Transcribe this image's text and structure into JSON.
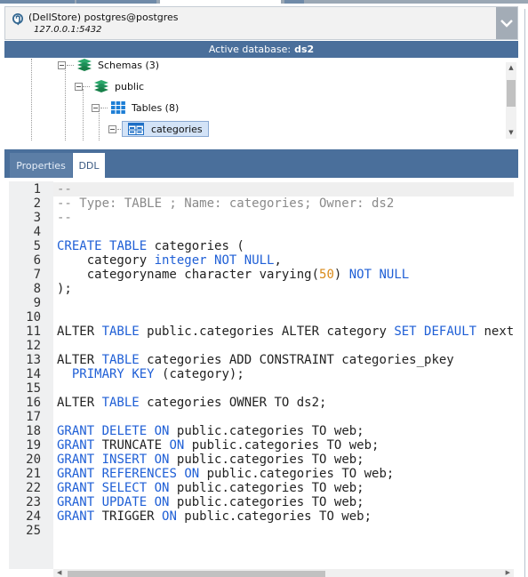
{
  "connection": {
    "title": "(DellStore) postgres@postgres",
    "host": "127.0.0.1:5432"
  },
  "active_database": {
    "label": "Active database:",
    "name": "ds2"
  },
  "tree": {
    "schemas": "Schemas (3)",
    "public": "public",
    "tables": "Tables (8)",
    "categories": "categories"
  },
  "tabs": {
    "properties": "Properties",
    "ddl": "DDL"
  },
  "colors": {
    "header_blue": "#4a6f9b",
    "keyword": "#1f5fd6",
    "comment": "#8a8a8a",
    "number": "#d98a1a"
  },
  "editor": {
    "line_numbers": [
      "1",
      "2",
      "3",
      "4",
      "5",
      "6",
      "7",
      "8",
      "9",
      "10",
      "11",
      "12",
      "13",
      "14",
      "15",
      "16",
      "17",
      "18",
      "19",
      "20",
      "21",
      "22",
      "23",
      "24",
      "25"
    ],
    "lines": [
      [
        [
          "com",
          "--"
        ]
      ],
      [
        [
          "com",
          "-- Type: TABLE ; Name: categories; Owner: ds2"
        ]
      ],
      [
        [
          "com",
          "--"
        ]
      ],
      [],
      [
        [
          "kw",
          "CREATE"
        ],
        [
          "plain",
          " "
        ],
        [
          "kw",
          "TABLE"
        ],
        [
          "plain",
          " categories ("
        ]
      ],
      [
        [
          "plain",
          "    category "
        ],
        [
          "kw",
          "integer"
        ],
        [
          "plain",
          " "
        ],
        [
          "kw",
          "NOT"
        ],
        [
          "plain",
          " "
        ],
        [
          "kw",
          "NULL"
        ],
        [
          "plain",
          ","
        ]
      ],
      [
        [
          "plain",
          "    categoryname character varying("
        ],
        [
          "num",
          "50"
        ],
        [
          "plain",
          ") "
        ],
        [
          "kw",
          "NOT"
        ],
        [
          "plain",
          " "
        ],
        [
          "kw",
          "NULL"
        ]
      ],
      [
        [
          "plain",
          ");"
        ]
      ],
      [],
      [],
      [
        [
          "plain",
          "ALTER "
        ],
        [
          "kw",
          "TABLE"
        ],
        [
          "plain",
          " public.categories ALTER category "
        ],
        [
          "kw",
          "SET"
        ],
        [
          "plain",
          " "
        ],
        [
          "kw",
          "DEFAULT"
        ],
        [
          "plain",
          " nextval"
        ]
      ],
      [],
      [
        [
          "plain",
          "ALTER "
        ],
        [
          "kw",
          "TABLE"
        ],
        [
          "plain",
          " categories ADD CONSTRAINT categories_pkey"
        ]
      ],
      [
        [
          "plain",
          "  "
        ],
        [
          "kw",
          "PRIMARY"
        ],
        [
          "plain",
          " "
        ],
        [
          "kw",
          "KEY"
        ],
        [
          "plain",
          " (category);"
        ]
      ],
      [],
      [
        [
          "plain",
          "ALTER "
        ],
        [
          "kw",
          "TABLE"
        ],
        [
          "plain",
          " categories OWNER TO ds2;"
        ]
      ],
      [],
      [
        [
          "kw",
          "GRANT"
        ],
        [
          "plain",
          " "
        ],
        [
          "kw",
          "DELETE"
        ],
        [
          "plain",
          " "
        ],
        [
          "kw",
          "ON"
        ],
        [
          "plain",
          " public.categories TO web;"
        ]
      ],
      [
        [
          "kw",
          "GRANT"
        ],
        [
          "plain",
          " TRUNCATE "
        ],
        [
          "kw",
          "ON"
        ],
        [
          "plain",
          " public.categories TO web;"
        ]
      ],
      [
        [
          "kw",
          "GRANT"
        ],
        [
          "plain",
          " "
        ],
        [
          "kw",
          "INSERT"
        ],
        [
          "plain",
          " "
        ],
        [
          "kw",
          "ON"
        ],
        [
          "plain",
          " public.categories TO web;"
        ]
      ],
      [
        [
          "kw",
          "GRANT"
        ],
        [
          "plain",
          " "
        ],
        [
          "kw",
          "REFERENCES"
        ],
        [
          "plain",
          " "
        ],
        [
          "kw",
          "ON"
        ],
        [
          "plain",
          " public.categories TO web;"
        ]
      ],
      [
        [
          "kw",
          "GRANT"
        ],
        [
          "plain",
          " "
        ],
        [
          "kw",
          "SELECT"
        ],
        [
          "plain",
          " "
        ],
        [
          "kw",
          "ON"
        ],
        [
          "plain",
          " public.categories TO web;"
        ]
      ],
      [
        [
          "kw",
          "GRANT"
        ],
        [
          "plain",
          " "
        ],
        [
          "kw",
          "UPDATE"
        ],
        [
          "plain",
          " "
        ],
        [
          "kw",
          "ON"
        ],
        [
          "plain",
          " public.categories TO web;"
        ]
      ],
      [
        [
          "kw",
          "GRANT"
        ],
        [
          "plain",
          " TRIGGER "
        ],
        [
          "kw",
          "ON"
        ],
        [
          "plain",
          " public.categories TO web;"
        ]
      ],
      []
    ]
  }
}
